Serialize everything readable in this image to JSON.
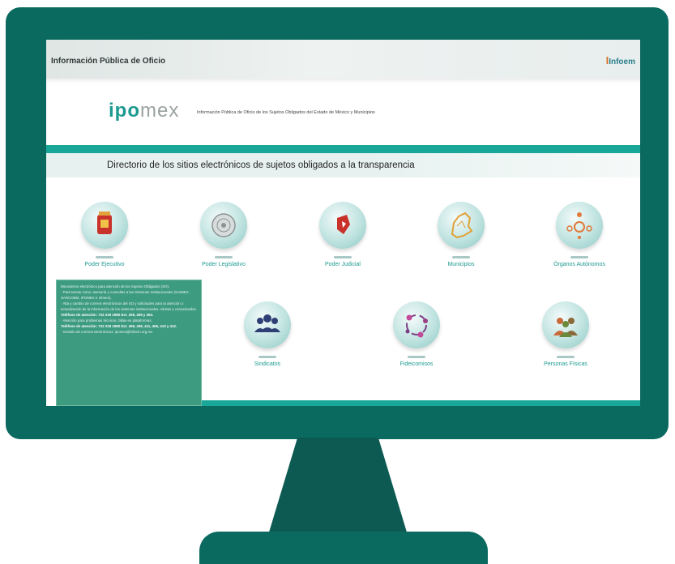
{
  "site": {
    "header_title": "Información Pública de Oficio",
    "header_logo": "Infoem",
    "brand": {
      "a": "ipo",
      "b": "mex"
    },
    "tagline": "Información Pública de Oficio de los Sujetos Obligados del Estado de México y Municipios",
    "page_title": "Directorio de los sitios electrónicos de sujetos obligados a la transparencia"
  },
  "categories": [
    {
      "label": "Poder Ejecutivo",
      "icon": "coat-of-arms-icon"
    },
    {
      "label": "Poder Legislativo",
      "icon": "legislature-seal-icon"
    },
    {
      "label": "Poder Judicial",
      "icon": "judicial-logo-icon"
    },
    {
      "label": "Municipios",
      "icon": "state-map-icon"
    },
    {
      "label": "Órganos Autónomos",
      "icon": "network-nodes-icon"
    },
    {
      "label": "Sindicatos",
      "icon": "people-group-icon"
    },
    {
      "label": "Fideicomisos",
      "icon": "cycle-arrows-icon"
    },
    {
      "label": "Personas Físicas",
      "icon": "persons-icon"
    }
  ],
  "tooltip": [
    "Mecanismo electrónico para atención de los Sujetos Obligados (SO).",
    "· Para temas como: asesoría y consultas a las Sistemas Institucionales (SAIMEX, SARCOEM, IPOMEX e Infoem).",
    "· Alta y cambio de correos electrónicos del SO y solicitudes para la atención o actualización de la información de los sistemas institucionales. Alertas y comunicados.",
    "Teléfono de atención: 722 226 1980 Ext. 208, 409 y 404.",
    "· Atención para problemas técnicos, fallas en plataformas.",
    "Teléfono de atención: 722 226 1980 Ext. 408, 409, 411, 405, 410 y 412.",
    "· Gestión de correos electrónicos: ipomex@infoem.org.mx"
  ],
  "colors": {
    "frame": "#0b6a60",
    "accent": "#19a79a",
    "tooltip": "#3d9b7f"
  }
}
